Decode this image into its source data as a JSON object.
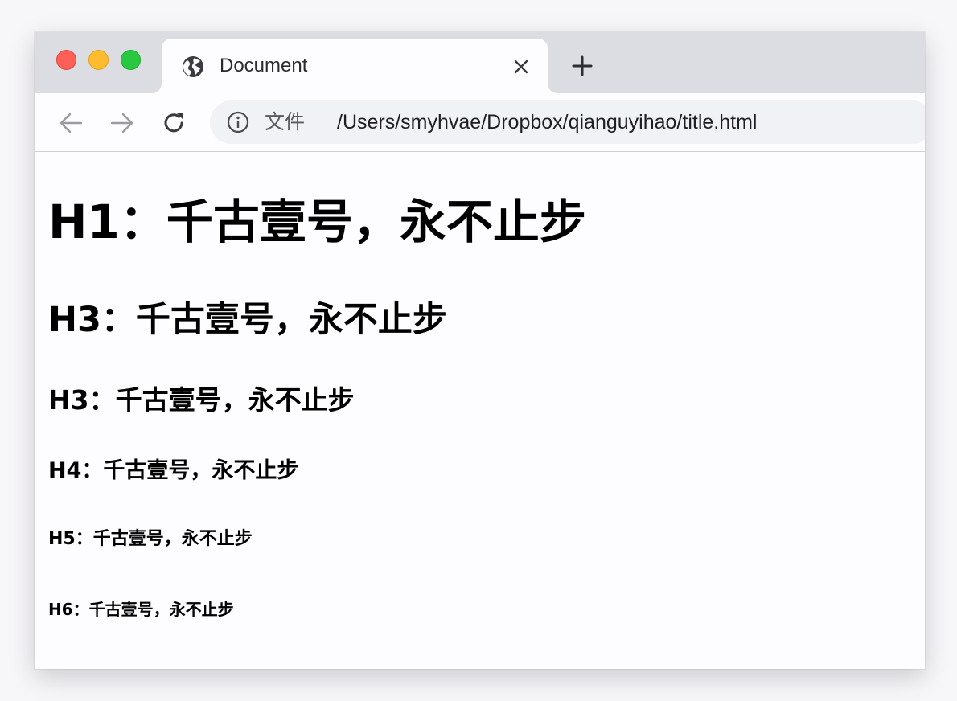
{
  "window": {
    "traffic_lights": {
      "close_color": "#fe5f57",
      "minimize_color": "#febc2e",
      "maximize_color": "#28c840"
    }
  },
  "tab": {
    "favicon": "globe-icon",
    "title": "Document",
    "close_icon": "close-icon",
    "new_tab_icon": "plus-icon"
  },
  "toolbar": {
    "back_icon": "arrow-left-icon",
    "forward_icon": "arrow-right-icon",
    "reload_icon": "reload-icon",
    "omnibox": {
      "info_icon": "info-icon",
      "scheme_label": "文件",
      "url": "/Users/smyhvae/Dropbox/qianguyihao/title.html"
    }
  },
  "page": {
    "headings": [
      "H1：千古壹号，永不止步",
      "H3：千古壹号，永不止步",
      "H3：千古壹号，永不止步",
      "H4：千古壹号，永不止步",
      "H5：千古壹号，永不止步",
      "H6：千古壹号，永不止步"
    ]
  }
}
